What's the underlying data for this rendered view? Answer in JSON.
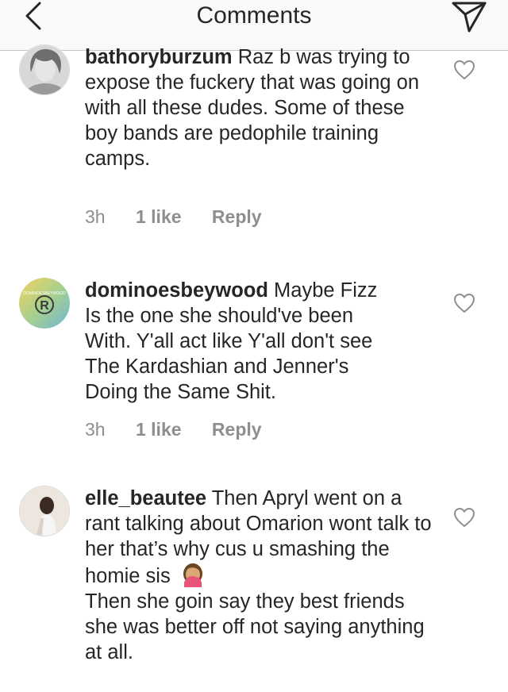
{
  "header": {
    "title": "Comments",
    "back_icon": "chevron-left-icon",
    "send_icon": "paper-plane-icon"
  },
  "comments": [
    {
      "username": "bathoryburzum",
      "text": "Raz b was trying to expose the fuckery that was going on with all these dudes. Some of these boy bands are pedophile training camps.",
      "time": "3h",
      "likes": "1 like",
      "reply": "Reply"
    },
    {
      "username": "dominoesbeywood",
      "avatar_text": "DOMINOESBEYWOOD",
      "avatar_symbol": "®",
      "text_lines": [
        "Maybe Fizz",
        "Is the one she should've been",
        "With. Y'all act like Y'all don't see",
        "The Kardashian and Jenner's",
        "Doing the Same Shit."
      ],
      "time": "3h",
      "likes": "1 like",
      "reply": "Reply"
    },
    {
      "username": "elle_beautee",
      "text_a": "Then Apryl went on a rant talking about Omarion wont talk to her that’s why cus u smashing the homie sis",
      "emoji": "woman-facepalming-emoji",
      "text_b": "Then she goin say they best friends she was better off not saying anything at all."
    }
  ],
  "colors": {
    "text": "#262626",
    "meta": "#8e8e8e",
    "header_bg": "#f9f9f9",
    "divider": "#c8c8c8"
  }
}
